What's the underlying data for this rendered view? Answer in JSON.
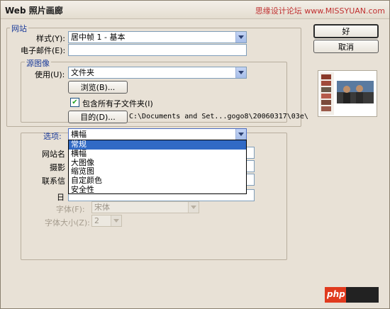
{
  "window": {
    "title": "Web 照片画廊"
  },
  "watermark": {
    "top_text": "思缘设计论坛 www.MISSYUAN.com",
    "bottom_text": "php"
  },
  "site": {
    "legend": "网站",
    "style_label": "样式(Y):",
    "style_value": "居中帧 1 - 基本",
    "email_label": "电子邮件(E):",
    "email_value": ""
  },
  "source": {
    "legend": "源图像",
    "use_label": "使用(U):",
    "use_value": "文件夹",
    "browse_label": "浏览(B)...",
    "include_subfolders_label": "包含所有子文件夹(I)",
    "include_subfolders_checked": true,
    "destination_label": "目的(D)...",
    "destination_path": "C:\\Documents and Set...gogo8\\20060317\\03e\\"
  },
  "options": {
    "label": "选项:",
    "value": "横幅",
    "dropdown_items": [
      "常规",
      "横幅",
      "大图像",
      "缩览图",
      "自定颜色",
      "安全性"
    ],
    "selected_index": 0,
    "field_labels": {
      "site_name": "网站名",
      "photographer": "摄影",
      "contact": "联系信",
      "date": "日",
      "font": "字体(F):",
      "font_size": "字体大小(Z):"
    },
    "font_value": "宋体",
    "font_size_value": "2"
  },
  "buttons": {
    "ok": "好",
    "cancel": "取消"
  }
}
